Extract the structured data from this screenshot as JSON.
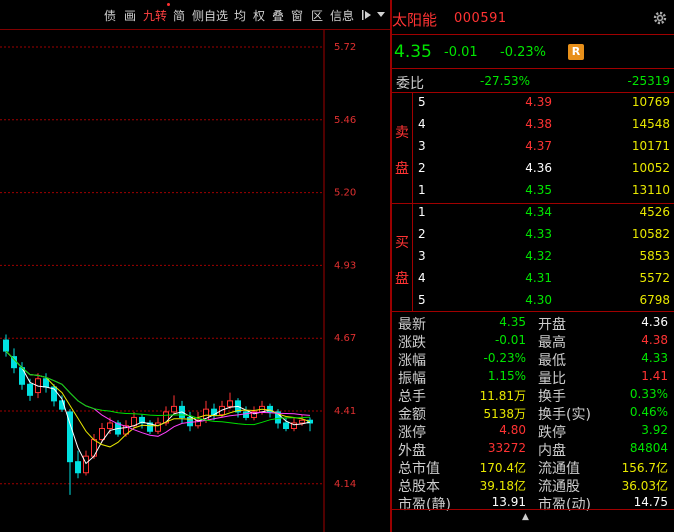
{
  "toolbar": {
    "items": [
      "债",
      "画",
      "九转",
      "简",
      "侧自选",
      "均",
      "权",
      "叠",
      "窗",
      "区",
      "信息"
    ],
    "active_index": 2,
    "pin_icon": "pin-icon",
    "menu_icon": "chevron-down-icon"
  },
  "chart": {
    "price_labels": [
      "5.72",
      "5.46",
      "5.20",
      "4.93",
      "4.67",
      "4.41",
      "4.14"
    ]
  },
  "quote": {
    "name": "太阳能",
    "code": "000591",
    "last": "4.35",
    "change": "-0.01",
    "change_pct": "-0.23%",
    "badge": "R",
    "weibi_label": "委比",
    "weibi_pct": "-27.53%",
    "weibi_diff": "-25319",
    "sell_label": "卖盘",
    "buy_label": "买盘",
    "sell": [
      {
        "level": "5",
        "price": "4.39",
        "vol": "10769",
        "color": "red"
      },
      {
        "level": "4",
        "price": "4.38",
        "vol": "14548",
        "color": "red"
      },
      {
        "level": "3",
        "price": "4.37",
        "vol": "10171",
        "color": "red"
      },
      {
        "level": "2",
        "price": "4.36",
        "vol": "10052",
        "color": "white"
      },
      {
        "level": "1",
        "price": "4.35",
        "vol": "13110",
        "color": "green"
      }
    ],
    "buy": [
      {
        "level": "1",
        "price": "4.34",
        "vol": "4526",
        "color": "green"
      },
      {
        "level": "2",
        "price": "4.33",
        "vol": "10582",
        "color": "green"
      },
      {
        "level": "3",
        "price": "4.32",
        "vol": "5853",
        "color": "green"
      },
      {
        "level": "4",
        "price": "4.31",
        "vol": "5572",
        "color": "green"
      },
      {
        "level": "5",
        "price": "4.30",
        "vol": "6798",
        "color": "green"
      }
    ],
    "stats": [
      {
        "l1": "最新",
        "v1": "4.35",
        "c1": "green",
        "l2": "开盘",
        "v2": "4.36",
        "c2": "white"
      },
      {
        "l1": "涨跌",
        "v1": "-0.01",
        "c1": "green",
        "l2": "最高",
        "v2": "4.38",
        "c2": "red"
      },
      {
        "l1": "涨幅",
        "v1": "-0.23%",
        "c1": "green",
        "l2": "最低",
        "v2": "4.33",
        "c2": "green"
      },
      {
        "l1": "振幅",
        "v1": "1.15%",
        "c1": "green",
        "l2": "量比",
        "v2": "1.41",
        "c2": "red"
      },
      {
        "l1": "总手",
        "v1": "11.81万",
        "c1": "yellow",
        "l2": "换手",
        "v2": "0.33%",
        "c2": "green"
      },
      {
        "l1": "金额",
        "v1": "5138万",
        "c1": "yellow",
        "l2": "换手(实)",
        "v2": "0.46%",
        "c2": "green"
      },
      {
        "l1": "涨停",
        "v1": "4.80",
        "c1": "red",
        "l2": "跌停",
        "v2": "3.92",
        "c2": "green"
      },
      {
        "l1": "外盘",
        "v1": "33272",
        "c1": "red",
        "l2": "内盘",
        "v2": "84804",
        "c2": "green"
      },
      {
        "l1": "总市值",
        "v1": "170.4亿",
        "c1": "yellow",
        "l2": "流通值",
        "v2": "156.7亿",
        "c2": "yellow"
      },
      {
        "l1": "总股本",
        "v1": "39.18亿",
        "c1": "yellow",
        "l2": "流通股",
        "v2": "36.03亿",
        "c2": "yellow"
      },
      {
        "l1": "市盈(静)",
        "v1": "13.91",
        "c1": "white",
        "l2": "市盈(动)",
        "v2": "14.75",
        "c2": "white"
      }
    ]
  },
  "colors": {
    "up": "#ff3333",
    "down": "#00e600",
    "volume": "#e8e800",
    "grid": "#a00000"
  }
}
